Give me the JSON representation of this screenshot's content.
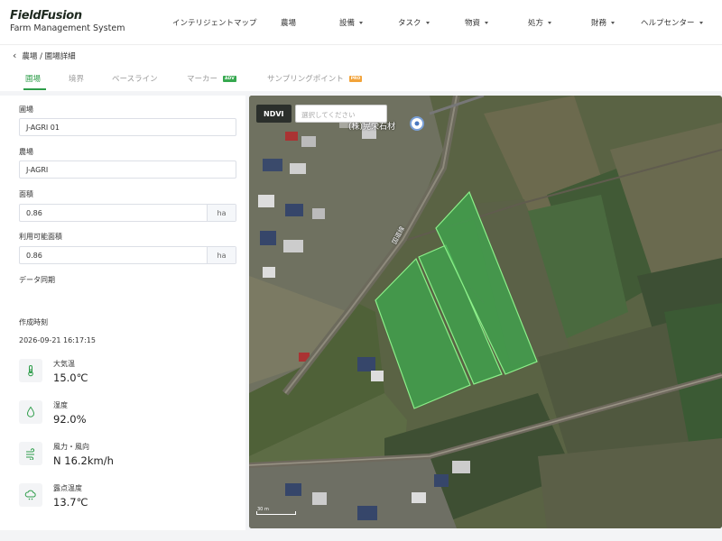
{
  "header": {
    "logo_main": "FieldFusion",
    "logo_sub": "Farm Management System",
    "nav": [
      {
        "label": "インテリジェントマップ",
        "dropdown": false
      },
      {
        "label": "農場",
        "dropdown": false
      },
      {
        "label": "設備",
        "dropdown": true
      },
      {
        "label": "タスク",
        "dropdown": true
      },
      {
        "label": "物資",
        "dropdown": true
      },
      {
        "label": "処方",
        "dropdown": true
      },
      {
        "label": "財務",
        "dropdown": true
      },
      {
        "label": "ヘルプセンター",
        "dropdown": true
      }
    ]
  },
  "breadcrumb": "農場 / 圃場詳細",
  "tabs": [
    {
      "label": "圃場",
      "active": true
    },
    {
      "label": "境界",
      "active": false
    },
    {
      "label": "ベースライン",
      "active": false
    },
    {
      "label": "マーカー",
      "active": false,
      "badge": "ADV"
    },
    {
      "label": "サンプリングポイント",
      "active": false,
      "badge": "PRO"
    }
  ],
  "form": {
    "field_label": "圃場",
    "field_value": "J-AGRI 01",
    "farm_label": "農場",
    "farm_value": "J-AGRI",
    "area_label": "面積",
    "area_value": "0.86",
    "area_unit": "ha",
    "usable_label": "利用可能面積",
    "usable_value": "0.86",
    "usable_unit": "ha",
    "sync_label": "データ同期",
    "created_label": "作成時刻",
    "created_value": "2026-09-21 16:17:15"
  },
  "weather": [
    {
      "icon": "thermometer-icon",
      "label": "大気温",
      "value": "15.0℃"
    },
    {
      "icon": "humidity-icon",
      "label": "湿度",
      "value": "92.0%"
    },
    {
      "icon": "wind-icon",
      "label": "風力・風向",
      "value": "N 16.2km/h"
    },
    {
      "icon": "dewpoint-icon",
      "label": "露点温度",
      "value": "13.7℃"
    }
  ],
  "map": {
    "layer_button": "NDVI",
    "select_placeholder": "選択してください",
    "place_label": "(株)晃栄石材",
    "road_label": "国道線",
    "scale_label": "30 m"
  },
  "colors": {
    "accent": "#2e9d4a",
    "field_fill": "#3ea84e",
    "field_stroke": "#8cf08a"
  }
}
